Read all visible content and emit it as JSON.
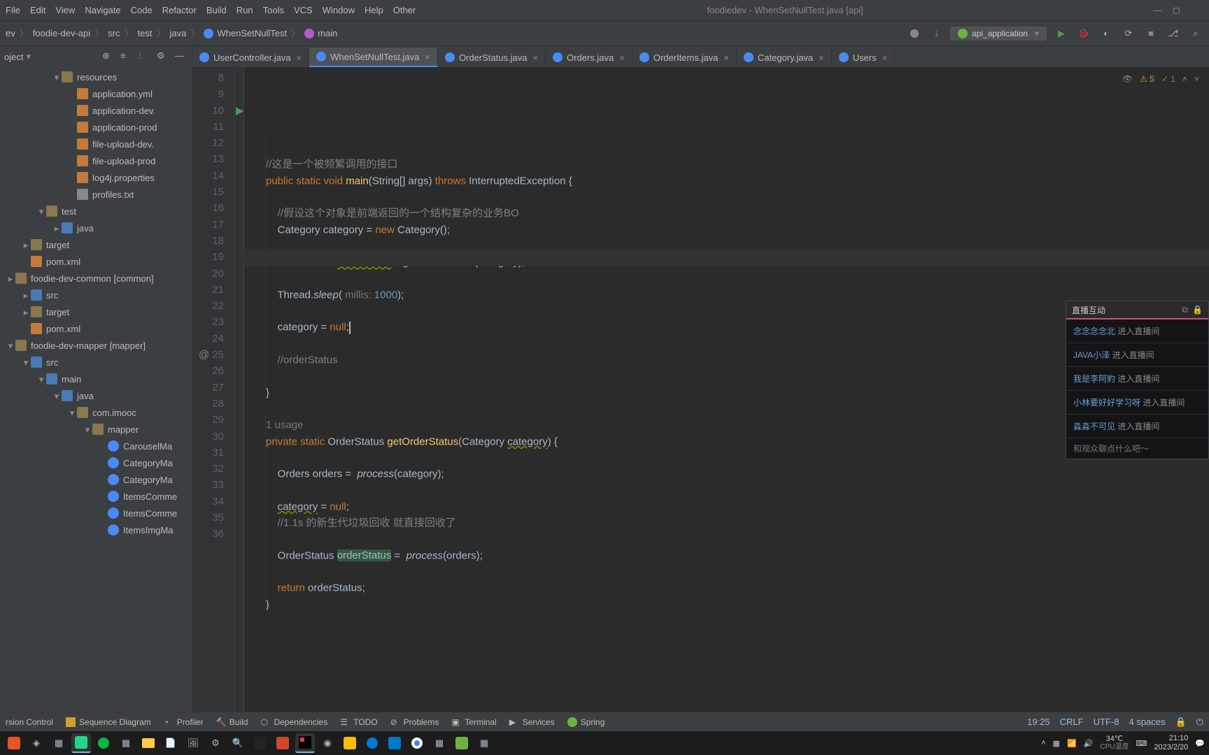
{
  "window": {
    "title": "foodiedev - WhenSetNullTest.java [api]"
  },
  "menu": [
    "File",
    "Edit",
    "View",
    "Navigate",
    "Code",
    "Refactor",
    "Build",
    "Run",
    "Tools",
    "VCS",
    "Window",
    "Help",
    "Other"
  ],
  "breadcrumb": {
    "parts": [
      "ev",
      "foodie-dev-api",
      "src",
      "test",
      "java",
      "WhenSetNullTest",
      "main"
    ]
  },
  "runconfig": {
    "label": "api_application"
  },
  "projectHeader": {
    "label": "oject"
  },
  "tree": [
    {
      "d": 3,
      "arrow": "▾",
      "icon": "folder",
      "label": "resources"
    },
    {
      "d": 4,
      "arrow": "",
      "icon": "yml",
      "label": "application.yml"
    },
    {
      "d": 4,
      "arrow": "",
      "icon": "yml",
      "label": "application-dev."
    },
    {
      "d": 4,
      "arrow": "",
      "icon": "yml",
      "label": "application-prod"
    },
    {
      "d": 4,
      "arrow": "",
      "icon": "yml",
      "label": "file-upload-dev."
    },
    {
      "d": 4,
      "arrow": "",
      "icon": "yml",
      "label": "file-upload-prod"
    },
    {
      "d": 4,
      "arrow": "",
      "icon": "yml",
      "label": "log4j.properties"
    },
    {
      "d": 4,
      "arrow": "",
      "icon": "txtf",
      "label": "profiles.txt"
    },
    {
      "d": 2,
      "arrow": "▾",
      "icon": "folder",
      "label": "test"
    },
    {
      "d": 3,
      "arrow": "▸",
      "icon": "folder blue",
      "label": "java"
    },
    {
      "d": 1,
      "arrow": "▸",
      "icon": "folder",
      "label": "target",
      "cls": "orange"
    },
    {
      "d": 1,
      "arrow": "",
      "icon": "mvn",
      "label": "pom.xml"
    },
    {
      "d": 0,
      "arrow": "▸",
      "icon": "folder",
      "label": "foodie-dev-common [common]"
    },
    {
      "d": 1,
      "arrow": "▸",
      "icon": "folder blue",
      "label": "src"
    },
    {
      "d": 1,
      "arrow": "▸",
      "icon": "folder",
      "label": "target",
      "cls": "orange"
    },
    {
      "d": 1,
      "arrow": "",
      "icon": "mvn",
      "label": "pom.xml"
    },
    {
      "d": 0,
      "arrow": "▾",
      "icon": "folder",
      "label": "foodie-dev-mapper [mapper]"
    },
    {
      "d": 1,
      "arrow": "▾",
      "icon": "folder blue",
      "label": "src"
    },
    {
      "d": 2,
      "arrow": "▾",
      "icon": "folder blue",
      "label": "main"
    },
    {
      "d": 3,
      "arrow": "▾",
      "icon": "folder blue",
      "label": "java"
    },
    {
      "d": 4,
      "arrow": "▾",
      "icon": "folder",
      "label": "com.imooc"
    },
    {
      "d": 5,
      "arrow": "▾",
      "icon": "folder",
      "label": "mapper"
    },
    {
      "d": 6,
      "arrow": "",
      "icon": "jfile",
      "label": "CarouselMa"
    },
    {
      "d": 6,
      "arrow": "",
      "icon": "jfile",
      "label": "CategoryMa"
    },
    {
      "d": 6,
      "arrow": "",
      "icon": "jfile",
      "label": "CategoryMa"
    },
    {
      "d": 6,
      "arrow": "",
      "icon": "jfile",
      "label": "ItemsComme"
    },
    {
      "d": 6,
      "arrow": "",
      "icon": "jfile",
      "label": "ItemsComme"
    },
    {
      "d": 6,
      "arrow": "",
      "icon": "jfile",
      "label": "ItemsImgMa"
    }
  ],
  "tabs": [
    {
      "label": "UserController.java"
    },
    {
      "label": "WhenSetNullTest.java",
      "active": true
    },
    {
      "label": "OrderStatus.java"
    },
    {
      "label": "Orders.java"
    },
    {
      "label": "OrderItems.java"
    },
    {
      "label": "Category.java"
    },
    {
      "label": "Users"
    }
  ],
  "gutter": {
    "start": 8,
    "end": 36,
    "runline": 10,
    "usage_line": 24,
    "override_line": 25
  },
  "inspect": {
    "warn": "5",
    "ok": "1"
  },
  "code": {
    "l8": "",
    "l9": "//这是一个被频繁调用的接口",
    "l10a": "public static void ",
    "l10b": "main",
    "l10c": "(String[] args) ",
    "l10d": "throws",
    "l10e": " InterruptedException {",
    "l11": "",
    "l12": "//假设这个对象是前端返回的一个结构复杂的业务BO",
    "l13a": "Category category = ",
    "l13b": "new",
    "l13c": " Category();",
    "l14": "",
    "l15a": "OrderStatus ",
    "l15b": "orderStatus",
    "l15c": " = ",
    "l15d": "getOrderStatus",
    "l15e": "(category);",
    "l16": "",
    "l17a": "Thread.",
    "l17b": "sleep",
    "l17c": "( ",
    "l17h": "millis: ",
    "l17d": "1000",
    "l17e": ");",
    "l18": "",
    "l19a": "category = ",
    "l19b": "null",
    "l19c": ";",
    "l20": "",
    "l21": "//orderStatus",
    "l22": "",
    "l23": "}",
    "l24": "",
    "l24u": "1 usage",
    "l25a": "private static ",
    "l25b": "OrderStatus ",
    "l25c": "getOrderStatus",
    "l25d": "(Category ",
    "l25e": "category",
    "l25f": ") {",
    "l26": "",
    "l27a": "Orders orders =  ",
    "l27b": "process",
    "l27c": "(category);",
    "l28": "",
    "l29a": "category",
    "l29b": " = ",
    "l29c": "null",
    "l29d": ";",
    "l30": "//1.1s 的新生代垃圾回收 就直接回收了",
    "l31": "",
    "l32a": "OrderStatus ",
    "l32b": "orderStatus",
    "l32c": " =  ",
    "l32d": "process",
    "l32e": "(orders);",
    "l33": "",
    "l34a": "return ",
    "l34b": "orderStatus;",
    "l35": "}",
    "l36": ""
  },
  "bottomtabs": [
    "rsion Control",
    "Sequence Diagram",
    "Profiler",
    "Build",
    "Dependencies",
    "TODO",
    "Problems",
    "Terminal",
    "Services",
    "Spring"
  ],
  "status": {
    "pos": "19:25",
    "eol": "CRLF",
    "enc": "UTF-8",
    "indent": "4 spaces"
  },
  "livechat": {
    "title": "直播互动",
    "msgs": [
      {
        "u": "念念念念北",
        "t": "进入直播间"
      },
      {
        "u": "JAVA小泽",
        "t": "进入直播间"
      },
      {
        "u": "我是李阿豹",
        "t": "进入直播间"
      },
      {
        "u": "小林要好好学习呀",
        "t": "进入直播间"
      },
      {
        "u": "淼淼不可见",
        "t": "进入直播间"
      }
    ],
    "input": "和观众聊点什么吧～"
  },
  "tray": {
    "temp": "34℃",
    "cpu": "CPU温度",
    "time": "21:10",
    "date": "2023/2/20"
  }
}
